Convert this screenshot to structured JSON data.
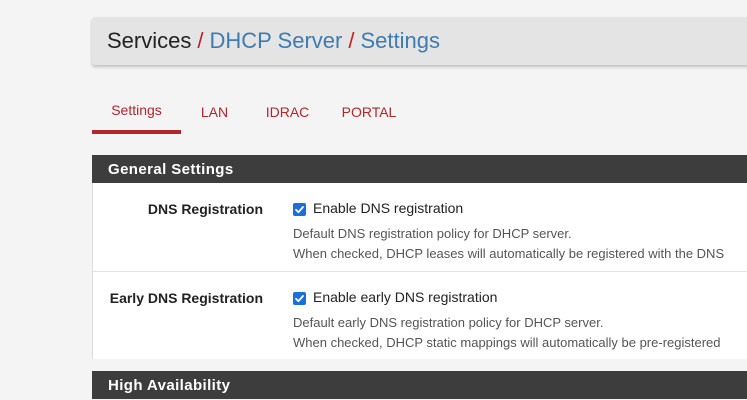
{
  "breadcrumb": {
    "items": [
      "Services",
      "DHCP Server",
      "Settings"
    ],
    "separator": "/"
  },
  "tabs": [
    {
      "label": "Settings",
      "active": true
    },
    {
      "label": "LAN",
      "active": false
    },
    {
      "label": "IDRAC",
      "active": false
    },
    {
      "label": "PORTAL",
      "active": false
    }
  ],
  "general": {
    "title": "General Settings",
    "rows": [
      {
        "label": "DNS Registration",
        "checkbox_label": "Enable DNS registration",
        "checked": true,
        "help1": "Default DNS registration policy for DHCP server.",
        "help2": "When checked, DHCP leases will automatically be registered with the DNS"
      },
      {
        "label": "Early DNS Registration",
        "checkbox_label": "Enable early DNS registration",
        "checked": true,
        "help1": "Default early DNS registration policy for DHCP server.",
        "help2": "When checked, DHCP static mappings will automatically be pre-registered"
      }
    ]
  },
  "high_availability": {
    "title": "High Availability"
  },
  "colors": {
    "accent": "#b1272a",
    "link": "#3c7cb3",
    "header_bg": "#3d3d3d",
    "checkbox": "#1a6fd9"
  }
}
